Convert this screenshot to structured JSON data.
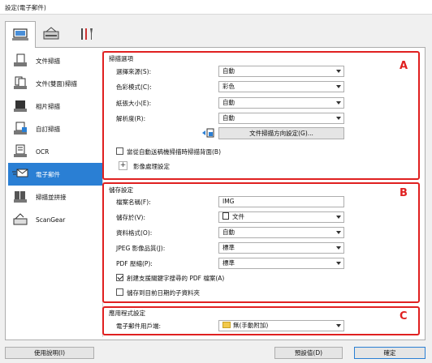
{
  "window": {
    "title": "設定(電子郵件)"
  },
  "tabs": [
    {
      "icon": "scan-from-computer-icon",
      "active": true
    },
    {
      "icon": "scan-from-panel-icon",
      "active": false
    },
    {
      "icon": "tools-icon",
      "active": false
    }
  ],
  "sidebar": {
    "items": [
      {
        "label": "文件掃描",
        "icon": "document-scan-icon",
        "selected": false
      },
      {
        "label": "文件(雙面)掃描",
        "icon": "duplex-scan-icon",
        "selected": false
      },
      {
        "label": "相片掃描",
        "icon": "photo-scan-icon",
        "selected": false
      },
      {
        "label": "自訂掃描",
        "icon": "custom-scan-icon",
        "selected": false
      },
      {
        "label": "OCR",
        "icon": "ocr-icon",
        "selected": false
      },
      {
        "label": "電子郵件",
        "icon": "email-icon",
        "selected": true
      },
      {
        "label": "掃描並拼接",
        "icon": "stitch-icon",
        "selected": false
      },
      {
        "label": "ScanGear",
        "icon": "scangear-icon",
        "selected": false
      }
    ]
  },
  "scan_options": {
    "title": "掃描選項",
    "letter": "A",
    "rows": [
      {
        "label": "選擇來源(S):",
        "value": "自動"
      },
      {
        "label": "色彩模式(C):",
        "value": "彩色"
      },
      {
        "label": "紙張大小(E):",
        "value": "自動"
      },
      {
        "label": "解析度(R):",
        "value": "自動"
      }
    ],
    "orientation_button": "文件掃描方向設定(G)...",
    "duplex_checkbox": {
      "label": "當從自動送稿機掃描時掃描背面(B)",
      "checked": false
    },
    "image_processing": "影像處理設定"
  },
  "save_settings": {
    "title": "儲存設定",
    "letter": "B",
    "file_name": {
      "label": "檔案名稱(F):",
      "value": "IMG"
    },
    "save_in": {
      "label": "儲存於(V):",
      "value": "文件"
    },
    "data_format": {
      "label": "資料格式(O):",
      "value": "自動"
    },
    "jpeg_quality": {
      "label": "JPEG 影像品質(J):",
      "value": "標準"
    },
    "pdf_compression": {
      "label": "PDF 壓縮(P):",
      "value": "標準"
    },
    "pdf_keyword_checkbox": {
      "label": "創建支援關鍵字搜尋的 PDF 檔案(A)",
      "checked": true
    },
    "date_subfolder_checkbox": {
      "label": "儲存到目前日期的子資料夾",
      "checked": false
    }
  },
  "app_settings": {
    "title": "應用程式設定",
    "letter": "C",
    "email_client": {
      "label": "電子郵件用戶端:",
      "value": "無(手動附加)"
    }
  },
  "footer": {
    "help_button": "使用說明(I)",
    "defaults_button": "預設值(D)",
    "ok_button": "確定"
  }
}
